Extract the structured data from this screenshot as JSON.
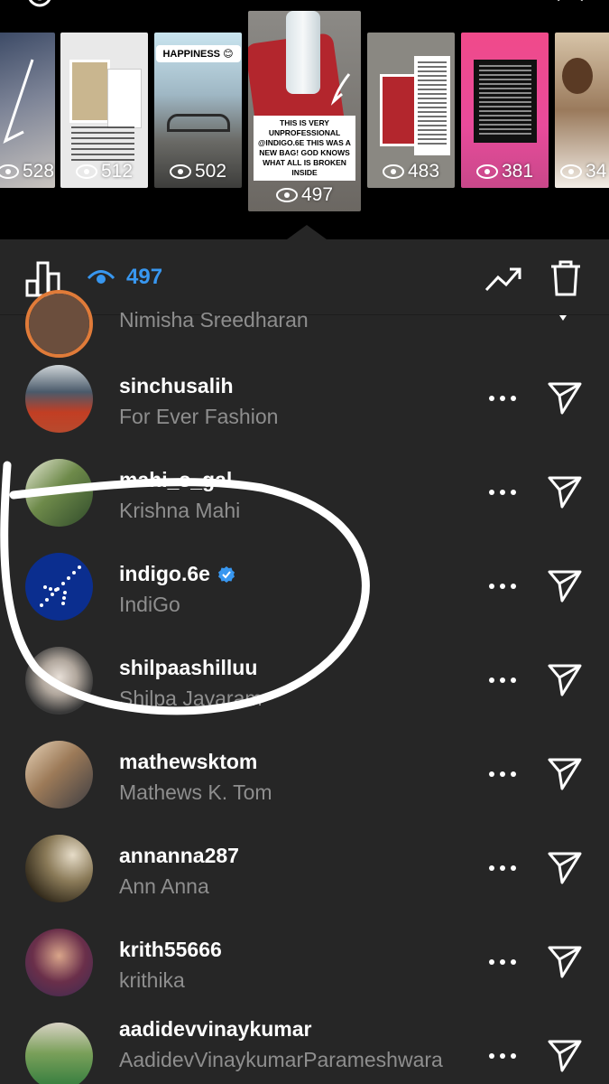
{
  "top_strip": {
    "stories": [
      {
        "views": "528"
      },
      {
        "views": "512"
      },
      {
        "views": "502",
        "badge": "HAPPINESS"
      },
      {
        "views": "497",
        "caption": "THIS IS VERY UNPROFESSIONAL @INDIGO.6E THIS WAS A NEW BAG! GOD KNOWS WHAT ALL IS BROKEN INSIDE"
      },
      {
        "views": "483"
      },
      {
        "views": "381"
      },
      {
        "views": "34"
      }
    ]
  },
  "stats_bar": {
    "view_count": "497"
  },
  "viewers": [
    {
      "username": "",
      "full_name": "Nimisha Sreedharan",
      "verified": false,
      "avatar_color": "#6b4e3d"
    },
    {
      "username": "sinchusalih",
      "full_name": "For Ever Fashion",
      "verified": false,
      "avatar_color": "#b84a2e"
    },
    {
      "username": "mahi_s_gal",
      "full_name": "Krishna Mahi",
      "verified": false,
      "avatar_color": "#4d6b3b"
    },
    {
      "username": "indigo.6e",
      "full_name": "IndiGo",
      "verified": true,
      "avatar_color": "#0b2e8f"
    },
    {
      "username": "shilpaashilluu",
      "full_name": "Shilpa Jayaram",
      "verified": false,
      "avatar_color": "#9a9a9a"
    },
    {
      "username": "mathewsktom",
      "full_name": "Mathews K. Tom",
      "verified": false,
      "avatar_color": "#7a6450"
    },
    {
      "username": "annanna287",
      "full_name": "Ann Anna",
      "verified": false,
      "avatar_color": "#5d4a30"
    },
    {
      "username": "krith55666",
      "full_name": "krithika",
      "verified": false,
      "avatar_color": "#6a2f4a"
    },
    {
      "username": "aadidevvinaykumar",
      "full_name": "AadidevVinaykumarParameshwara",
      "verified": false,
      "avatar_color": "#2e7a3c"
    }
  ],
  "colors": {
    "background": "#262626",
    "accent_blue": "#3897f0",
    "secondary_text": "#8e8e8e"
  }
}
